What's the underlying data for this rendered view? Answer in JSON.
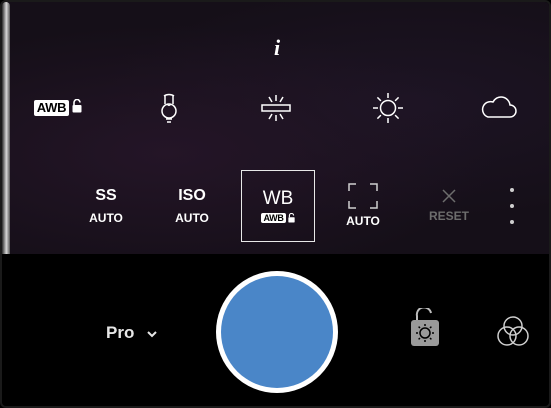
{
  "info_icon_glyph": "i",
  "white_balance_presets": [
    {
      "id": "awb",
      "label": "AWB",
      "icon": "awb-lock-icon"
    },
    {
      "id": "incandescent",
      "icon": "lightbulb-icon"
    },
    {
      "id": "fluorescent",
      "icon": "fluorescent-icon"
    },
    {
      "id": "daylight",
      "icon": "sun-icon"
    },
    {
      "id": "cloudy",
      "icon": "cloud-icon"
    }
  ],
  "controls": [
    {
      "id": "ss",
      "label": "SS",
      "value": "AUTO"
    },
    {
      "id": "iso",
      "label": "ISO",
      "value": "AUTO"
    },
    {
      "id": "wb",
      "label": "WB",
      "value": "AWB",
      "selected": true
    },
    {
      "id": "focus",
      "label": "",
      "value": "AUTO",
      "icon": "focus-frame-icon"
    },
    {
      "id": "reset",
      "label": "",
      "value": "RESET",
      "icon": "close-icon",
      "disabled": true
    }
  ],
  "mode": {
    "label": "Pro",
    "icon": "chevron-down-icon"
  },
  "shutter": {
    "icon": "shutter-button",
    "color": "#4a86c8"
  },
  "right_buttons": [
    {
      "id": "ae-lock",
      "icon": "exposure-lock-icon"
    },
    {
      "id": "filters",
      "icon": "color-filter-icon"
    }
  ],
  "colors": {
    "viewfinder": "#150f18",
    "accent_blue": "#4a86c8",
    "disabled": "#6d6d6d"
  }
}
